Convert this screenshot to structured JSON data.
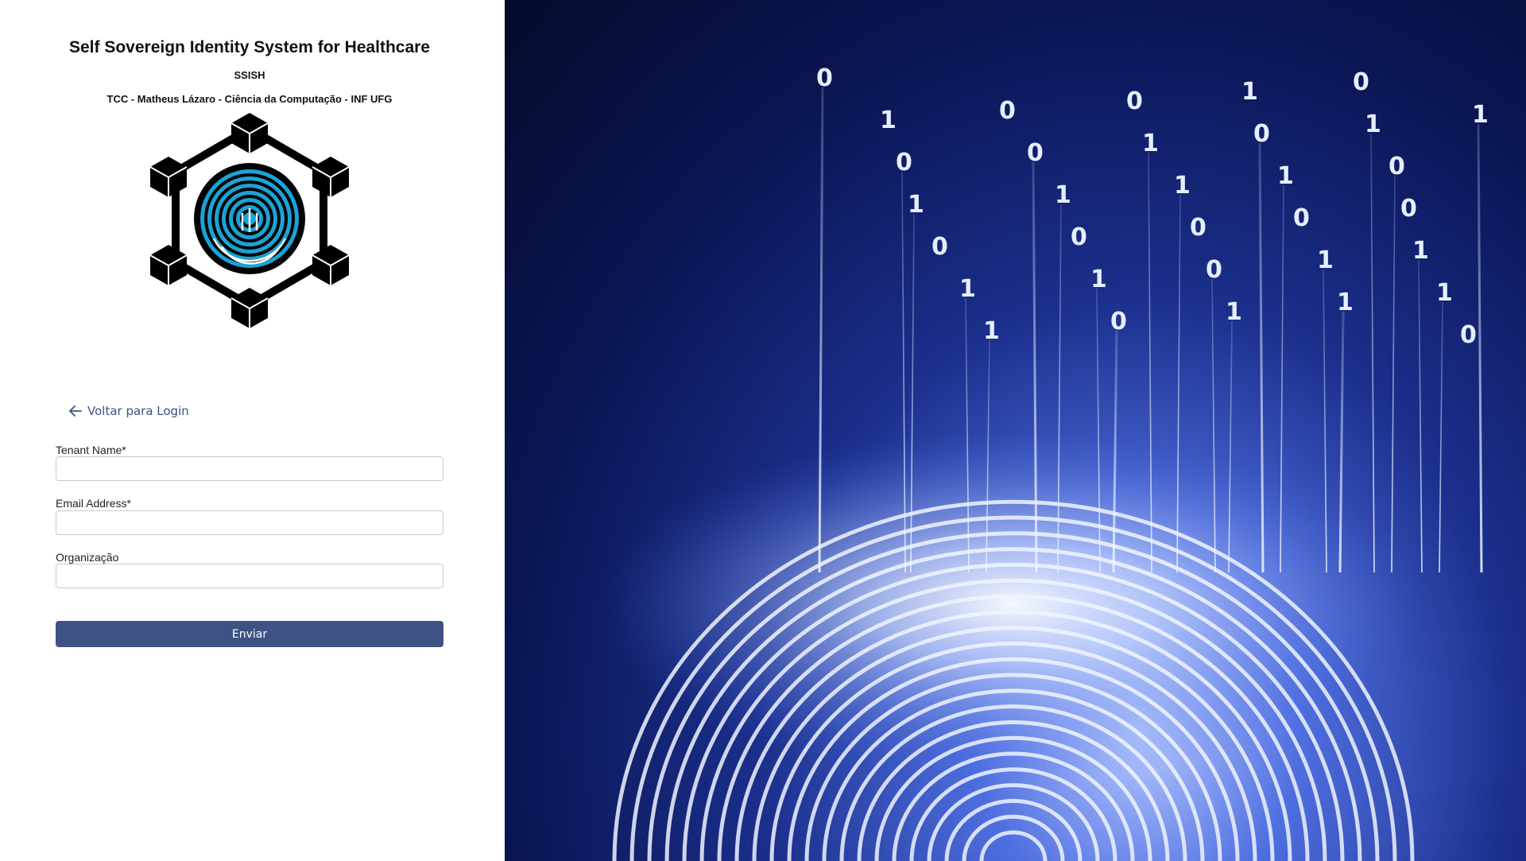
{
  "header": {
    "title": "Self Sovereign Identity System for Healthcare",
    "subtitle": "SSISH",
    "credits": "TCC - Matheus Lázaro - Ciência da Computação - INF UFG"
  },
  "logo": {
    "icon": "blockchain-fingerprint-icon"
  },
  "back_link": {
    "label": "Voltar para Login",
    "icon": "arrow-left-icon"
  },
  "form": {
    "tenant_name": {
      "label": "Tenant Name*",
      "value": "",
      "placeholder": ""
    },
    "email": {
      "label": "Email Address*",
      "value": "",
      "placeholder": ""
    },
    "organization": {
      "label": "Organização",
      "value": "",
      "placeholder": ""
    },
    "submit_label": "Enviar"
  },
  "hero": {
    "description_icon": "digital-fingerprint-binary-image"
  },
  "colors": {
    "accent": "#3e5283",
    "link": "#3c5281"
  }
}
